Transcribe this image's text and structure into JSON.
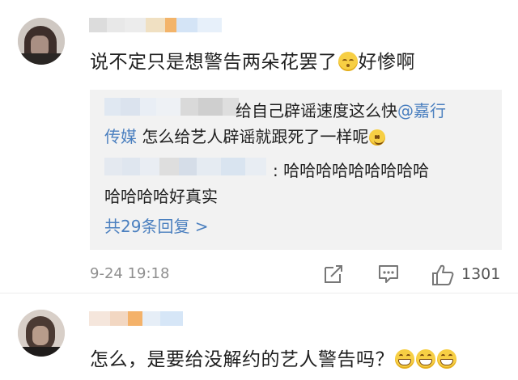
{
  "comment1": {
    "text": "说不定只是想警告两朵花罢了",
    "text_suffix": "好惨啊",
    "emoji": "sleepy-face"
  },
  "replies": [
    {
      "text_prefix": "给自己辟谣速度这么快",
      "mention": "@嘉行",
      "mention_cont": "传媒",
      "text_suffix": " 怎么给艺人辟谣就跟死了一样呢",
      "emoji": "smile-face"
    },
    {
      "text_line1": ": 哈哈哈哈哈哈哈哈哈",
      "text_line2": "哈哈哈哈好真实"
    }
  ],
  "reply_more": "共29条回复 >",
  "footer": {
    "time": "9-24 19:18",
    "likes": "1301",
    "icons": [
      "share-icon",
      "comment-icon",
      "like-icon"
    ]
  },
  "comment2": {
    "text": "怎么，是要给没解约的艺人警告吗？",
    "emoji": "grinning-face"
  }
}
